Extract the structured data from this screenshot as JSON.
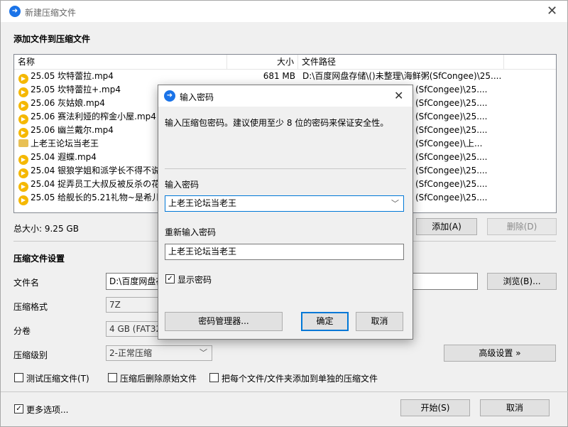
{
  "main": {
    "title": "新建压缩文件",
    "add_section": "添加文件到压缩文件",
    "columns": {
      "name": "名称",
      "size": "大小",
      "path": "文件路径"
    },
    "files": [
      {
        "icon": "media-file-icon",
        "name": "25.05 坎特蕾拉.mp4",
        "size": "681 MB",
        "path": "D:\\百度网盘存储\\()未整理\\海鲜粥(SfCongee)\\25...."
      },
      {
        "icon": "media-file-icon",
        "name": "25.05 坎特蕾拉+.mp4",
        "size": "",
        "path": "(SfCongee)\\25...."
      },
      {
        "icon": "media-file-icon",
        "name": "25.06 灰姑娘.mp4",
        "size": "",
        "path": "(SfCongee)\\25...."
      },
      {
        "icon": "media-file-icon",
        "name": "25.06 赛法利娅的榨金小屋.mp4",
        "size": "",
        "path": "(SfCongee)\\25...."
      },
      {
        "icon": "media-file-icon",
        "name": "25.06 幽兰戴尔.mp4",
        "size": "",
        "path": "(SfCongee)\\25...."
      },
      {
        "icon": "folder-icon",
        "name": "上老王论坛当老王",
        "size": "",
        "path": "(SfCongee)\\上..."
      },
      {
        "icon": "media-file-icon",
        "name": "25.04 遐蝶.mp4",
        "size": "",
        "path": "(SfCongee)\\25...."
      },
      {
        "icon": "media-file-icon",
        "name": "25.04 银狼学姐和派学长不得不说",
        "size": "",
        "path": "(SfCongee)\\25...."
      },
      {
        "icon": "media-file-icon",
        "name": "25.04 捉弄员工大叔反被反杀の花",
        "size": "",
        "path": "(SfCongee)\\25...."
      },
      {
        "icon": "media-file-icon",
        "name": "25.05 给舰长的5.21礼物~是希儿",
        "size": "",
        "path": "(SfCongee)\\25...."
      }
    ],
    "total_size": "总大小: 9.25 GB",
    "add_button": "添加(A)",
    "delete_button": "删除(D)",
    "settings_section": "压缩文件设置",
    "filename_label": "文件名",
    "filename_value": "D:\\百度网盘存",
    "browse_button": "浏览(B)...",
    "format_label": "压缩格式",
    "format_value": "7Z",
    "volume_label": "分卷",
    "volume_value": "4 GB (FAT32",
    "level_label": "压缩级别",
    "level_value": "2-正常压缩",
    "advanced_button": "高级设置 »",
    "chk_test": "测试压缩文件(T)",
    "chk_delete": "压缩后删除原始文件",
    "chk_separate": "把每个文件/文件夹添加到单独的压缩文件",
    "more_options": "更多选项...",
    "start_button": "开始(S)",
    "cancel_button": "取消"
  },
  "dialog": {
    "title": "输入密码",
    "description": "输入压缩包密码。建议使用至少 8 位的密码来保证安全性。",
    "password_label": "输入密码",
    "password_value": "上老王论坛当老王",
    "reenter_label": "重新输入密码",
    "reenter_value": "上老王论坛当老王",
    "show_password": "显示密码",
    "manager_button": "密码管理器...",
    "ok_button": "确定",
    "cancel_button": "取消"
  },
  "colors": {
    "accent": "#0078d7",
    "file_icon": "#f5b800"
  }
}
